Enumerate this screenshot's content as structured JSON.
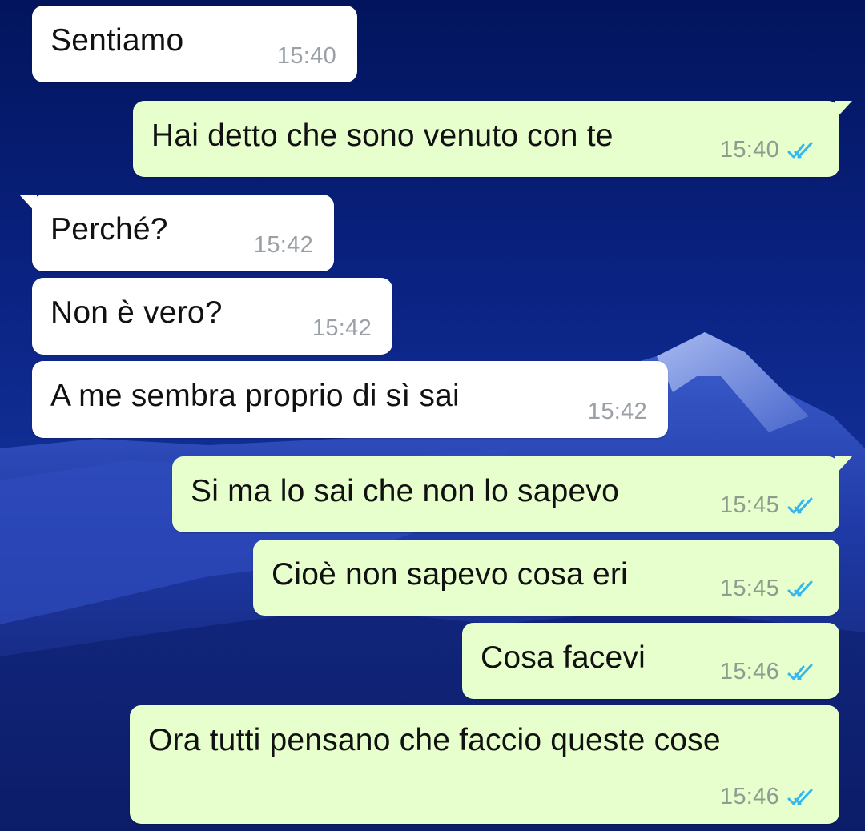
{
  "background": {
    "sky_color": "#0a2383",
    "mountain_color": "#1b3aa8",
    "snow_color": "#8fa8e8"
  },
  "colors": {
    "incoming_bubble": "#ffffff",
    "outgoing_bubble": "#e6ffcc",
    "read_ticks": "#34b7f1"
  },
  "messages": [
    {
      "direction": "in",
      "text": "Sentiamo",
      "time": "15:40"
    },
    {
      "direction": "out",
      "text": "Hai detto che sono venuto con te",
      "time": "15:40",
      "status": "read"
    },
    {
      "direction": "in",
      "text": "Perché?",
      "time": "15:42"
    },
    {
      "direction": "in",
      "text": "Non è vero?",
      "time": "15:42"
    },
    {
      "direction": "in",
      "text": "A me sembra proprio di sì sai",
      "time": "15:42"
    },
    {
      "direction": "out",
      "text": "Si ma lo sai che non lo sapevo",
      "time": "15:45",
      "status": "read"
    },
    {
      "direction": "out",
      "text": "Cioè non sapevo cosa eri",
      "time": "15:45",
      "status": "read"
    },
    {
      "direction": "out",
      "text": "Cosa facevi",
      "time": "15:46",
      "status": "read"
    },
    {
      "direction": "out",
      "text": "Ora tutti pensano che faccio queste cose",
      "time": "15:46",
      "status": "read"
    }
  ]
}
